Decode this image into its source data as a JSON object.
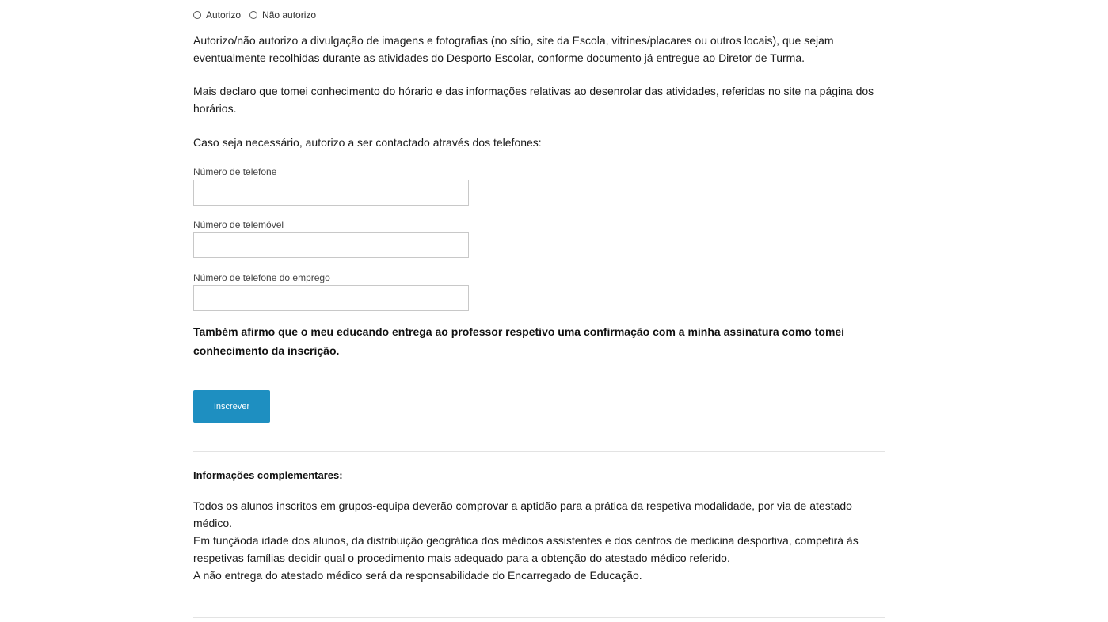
{
  "image_consent": {
    "options": [
      {
        "label": "Autorizo",
        "selected": false
      },
      {
        "label": "Não autorizo",
        "selected": false
      }
    ],
    "text": "Autorizo/não autorizo a divulgação de imagens e fotografias (no sítio, site da Escola, vitrines/placares ou outros locais), que sejam eventualmente recolhidas durante as atividades do Desporto Escolar, conforme documento já entregue ao Diretor de Turma."
  },
  "declaration": {
    "text": "Mais declaro que tomei conhecimento do hórario e das informações relativas ao desenrolar das atividades, referidas no site na página dos horários."
  },
  "contact": {
    "intro": "Caso seja necessário, autorizo a ser contactado através dos telefones:",
    "fields": [
      {
        "label": "Número de telefone",
        "value": "",
        "placeholder": ""
      },
      {
        "label": "Número de telemóvel",
        "value": "",
        "placeholder": ""
      },
      {
        "label": "Número de telefone do emprego",
        "value": "",
        "placeholder": ""
      }
    ]
  },
  "confirmation": {
    "text": "Também afirmo que o meu educando entrega ao professor respetivo uma confirmação com a minha assinatura como tomei conhecimento da inscrição."
  },
  "submit": {
    "label": "Inscrever"
  },
  "info": {
    "title": "Informações complementares:",
    "paragraphs": [
      "Todos os alunos inscritos em grupos-equipa deverão comprovar a aptidão para a prática da respetiva modalidade, por via de atestado médico.",
      "Em funçãoda idade dos alunos, da distribuição geográfica dos médicos assistentes e dos centros de medicina desportiva, competirá às respetivas famílias decidir qual o procedimento mais adequado para a obtenção do atestado médico referido.",
      "A não entrega do atestado médico será da responsabilidade do Encarregado de Educação."
    ]
  },
  "colors": {
    "button_bg": "#1e8fc1",
    "button_text": "#ffffff",
    "divider": "#e3e3e3",
    "input_border": "#c8c8c8"
  }
}
